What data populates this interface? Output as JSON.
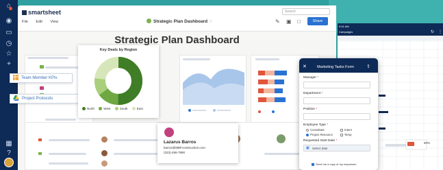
{
  "app": {
    "brand": "smartsheet",
    "menu": [
      "File",
      "Edit",
      "View"
    ],
    "sheet_title": "Strategic Plan Dashboard",
    "search_placeholder": "Search",
    "share_label": "Share"
  },
  "dashboard": {
    "title": "Strategic Plan Dashboard",
    "kpi_links": [
      {
        "label": "Team Member KPIs",
        "icon": "sheet-icon"
      },
      {
        "label": "Project Protocols",
        "icon": "cloud-drive-icon"
      }
    ],
    "donut": {
      "title": "Key Deals by Region",
      "legend": [
        "North",
        "West",
        "South",
        "East"
      ],
      "colors": [
        "#3f7d26",
        "#6fa843",
        "#a9cf7c",
        "#d6e6b8"
      ]
    },
    "contact": {
      "name": "Lazarus Barros",
      "email": "barros@MBFconstruction.com",
      "phone": "(323)-456-7890"
    }
  },
  "gantt": {
    "time": "9:41 AM",
    "label": "Campaigns",
    "popup_value": "60%"
  },
  "form": {
    "title": "Marketing Tasks Form",
    "fields": [
      "Manager",
      "Department",
      "Position",
      "Employee Type",
      "Requested Start Date"
    ],
    "employee_type_options": [
      "Consultant",
      "Intern",
      "Project Resource",
      "Temp"
    ],
    "date_placeholder": "Select date",
    "copy_label": "Send me a copy of my responses"
  },
  "colors": {
    "navy": "#0e2a56",
    "teal": "#2f9fa0",
    "blue": "#2a72d1",
    "orange": "#e0553b"
  }
}
